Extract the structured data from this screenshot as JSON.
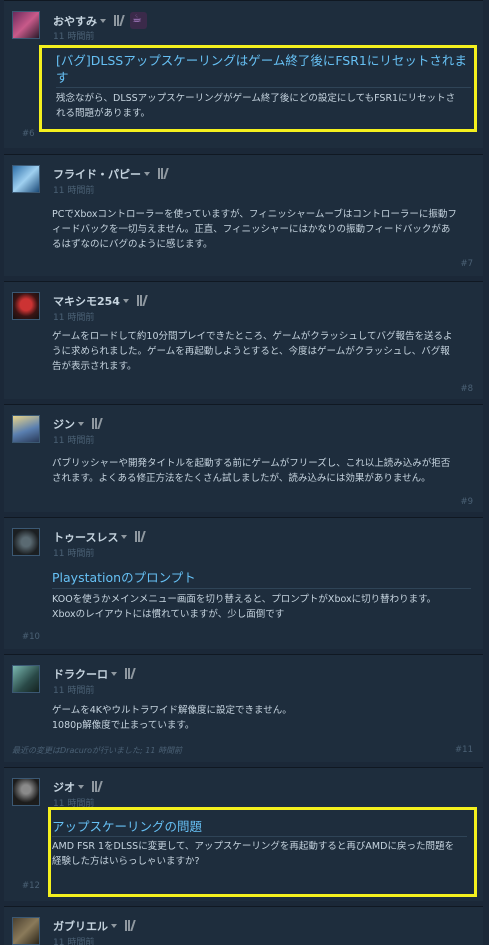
{
  "posts": [
    {
      "author": "おやすみ",
      "time": "11 時間前",
      "title": "[バグ]DLSSアップスケーリングはゲーム終了後にFSR1にリセットされます",
      "title_lines": [
        "[バグ]DLSSアップスケーリングはゲーム終了後にFSR1にリセットされま",
        "す"
      ],
      "body_lines": [
        "残念ながら、DLSSアップスケーリングがゲーム終了後にどの設定にしてもFSR1にリセットさ",
        "れる問題があります。"
      ],
      "num": "#6",
      "has_badge": true,
      "badge_icon": "coffee-cup-icon"
    },
    {
      "author": "フライド・パピー",
      "time": "11 時間前",
      "body_lines": [
        "PCでXboxコントローラーを使っていますが、フィニッシャームーブはコントローラーに振動フ",
        "ィードバックを一切与えません。正直、フィニッシャーにはかなりの振動フィードバックがあ",
        "るはずなのにバグのように感じます。"
      ],
      "num": "#7"
    },
    {
      "author": "マキシモ254",
      "time": "11 時間前",
      "body_lines": [
        "ゲームをロードして約10分間プレイできたところ、ゲームがクラッシュしてバグ報告を送るよ",
        "うに求められました。ゲームを再起動しようとすると、今度はゲームがクラッシュし、バグ報",
        "告が表示されます。"
      ],
      "num": "#8"
    },
    {
      "author": "ジン",
      "time": "11 時間前",
      "body_lines": [
        "パブリッシャーや開発タイトルを起動する前にゲームがフリーズし、これ以上読み込みが拒否",
        "されます。よくある修正方法をたくさん試しましたが、読み込みには効果がありません。"
      ],
      "num": "#9"
    },
    {
      "author": "トゥースレス",
      "time": "11 時間前",
      "title": "Playstationのプロンプト",
      "body_lines": [
        "KOOを使うかメインメニュー画面を切り替えると、プロンプトがXboxに切り替わります。",
        "Xboxのレイアウトには慣れていますが、少し面倒です"
      ],
      "num": "#10"
    },
    {
      "author": "ドラクーロ",
      "time": "11 時間前",
      "body_lines": [
        "ゲームを4Kやウルトラワイド解像度に設定できません。",
        "1080p解像度で止まっています。"
      ],
      "edit": "最近の変更はDracuroが行いました; 11 時間前",
      "num": "#11"
    },
    {
      "author": "ジオ",
      "time": "11 時間前",
      "title": "アップスケーリングの問題",
      "body_lines": [
        "AMD FSR 1をDLSSに変更して、アップスケーリングを再起動すると再びAMDに戻った問題を",
        "経験した方はいらっしゃいますか?"
      ],
      "num": "#12"
    },
    {
      "author": "ガブリエル",
      "time": "11 時間前"
    }
  ],
  "colors": {
    "background": "#1b2838",
    "post_background": "#1e2d3d",
    "title_link": "#66c0f4",
    "highlight_box": "#f4f01e",
    "muted": "#4b6175"
  }
}
